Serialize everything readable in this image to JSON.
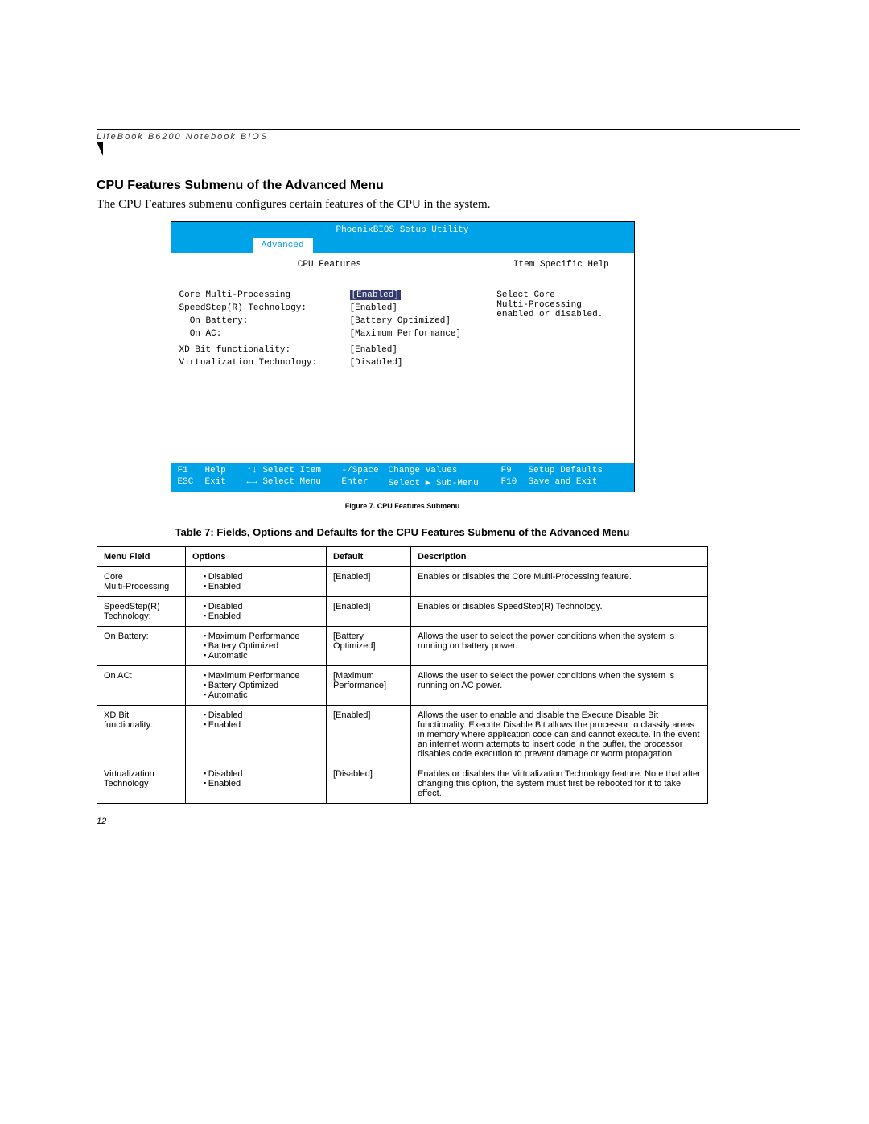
{
  "header": {
    "running": "LifeBook B6200 Notebook BIOS"
  },
  "section": {
    "title": "CPU Features Submenu of the Advanced Menu",
    "intro": "The CPU Features submenu configures certain features of the CPU in the system."
  },
  "bios": {
    "utility_title": "PhoenixBIOS Setup Utility",
    "active_tab": "Advanced",
    "left_title": "CPU Features",
    "right_title": "Item Specific Help",
    "help_text": "Select Core\nMulti-Processing\nenabled or disabled.",
    "items": [
      {
        "label": "Core Multi-Processing",
        "value": "[Enabled]",
        "selected": true
      },
      {
        "label": "SpeedStep(R) Technology:",
        "value": "[Enabled]",
        "selected": false
      },
      {
        "label": "  On Battery:",
        "value": "[Battery Optimized]",
        "selected": false
      },
      {
        "label": "  On AC:",
        "value": "[Maximum Performance]",
        "selected": false
      },
      {
        "label": "",
        "value": "",
        "selected": false
      },
      {
        "label": "XD Bit functionality:",
        "value": "[Enabled]",
        "selected": false
      },
      {
        "label": "Virtualization Technology:",
        "value": "[Disabled]",
        "selected": false
      }
    ],
    "footer": {
      "r1": {
        "k1": "F1",
        "l1": "Help",
        "k2": "↑↓",
        "l2": "Select Item",
        "k3": "-/Space",
        "l3": "Change Values",
        "k4": "F9",
        "l4": "Setup Defaults"
      },
      "r2": {
        "k1": "ESC",
        "l1": "Exit",
        "k2": "←→",
        "l2": "Select Menu",
        "k3": "Enter",
        "l3": "Select ▶ Sub-Menu",
        "k4": "F10",
        "l4": "Save and Exit"
      }
    }
  },
  "figure_caption": "Figure 7.  CPU Features Submenu",
  "table": {
    "title": "Table 7: Fields, Options and Defaults for the CPU Features Submenu of the Advanced Menu",
    "headers": [
      "Menu Field",
      "Options",
      "Default",
      "Description"
    ],
    "rows": [
      {
        "field": "Core\nMulti-Processing",
        "options": [
          "Disabled",
          "Enabled"
        ],
        "default": "[Enabled]",
        "desc": "Enables or disables the Core Multi-Processing feature."
      },
      {
        "field": "SpeedStep(R)\nTechnology:",
        "options": [
          "Disabled",
          "Enabled"
        ],
        "default": "[Enabled]",
        "desc": "Enables or disables SpeedStep(R) Technology."
      },
      {
        "field": "On Battery:",
        "options": [
          "Maximum Performance",
          "Battery Optimized",
          "Automatic"
        ],
        "default": "[Battery\nOptimized]",
        "desc": "Allows the user to select the power conditions when the system is running on battery power."
      },
      {
        "field": "On AC:",
        "options": [
          "Maximum Performance",
          "Battery Optimized",
          "Automatic"
        ],
        "default": "[Maximum\nPerformance]",
        "desc": "Allows the user to select the power conditions when the system is running on AC power."
      },
      {
        "field": "XD Bit\nfunctionality:",
        "options": [
          "Disabled",
          "Enabled"
        ],
        "default": "[Enabled]",
        "desc": "Allows the user to enable and disable the Execute Disable Bit functionality. Execute Disable Bit allows the processor to classify areas in memory where application code can and cannot execute. In the event an internet worm attempts to insert code in the buffer, the processor disables code execution to prevent damage or worm propagation."
      },
      {
        "field": "Virtualization\nTechnology",
        "options": [
          "Disabled",
          "Enabled"
        ],
        "default": "[Disabled]",
        "desc": "Enables or disables the Virtualization Technology feature. Note that after changing this option, the system must first be rebooted for it to take effect."
      }
    ]
  },
  "page_number": "12"
}
